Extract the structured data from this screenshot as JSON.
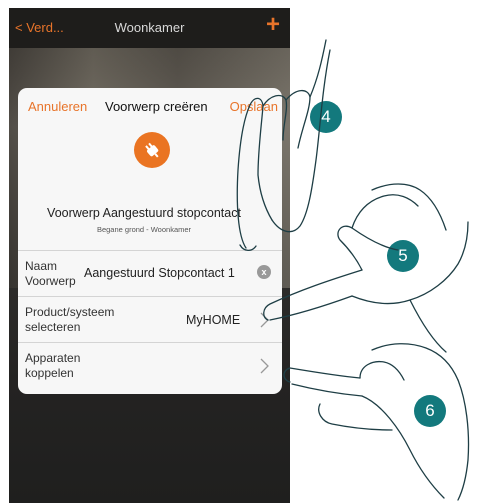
{
  "navbar": {
    "back_label": "< Verd...",
    "title": "Woonkamer",
    "add_label": "+"
  },
  "dialog": {
    "cancel_label": "Annuleren",
    "title": "Voorwerp creëren",
    "save_label": "Opslaan",
    "object_icon": "plug-icon",
    "object_name": "Voorwerp Aangestuurd stopcontact",
    "object_location": "Begane grond - Woonkamer",
    "rows": [
      {
        "label_line1": "Naam",
        "label_line2": "Voorwerp",
        "value": "Aangestuurd Stopcontact 1",
        "action": "x"
      },
      {
        "label_line1": "Product/systeem",
        "label_line2": "selecteren",
        "value": "MyHOME",
        "action": "chevron"
      },
      {
        "label_line1": "Apparaten",
        "label_line2": "koppelen",
        "value": "",
        "action": "chevron"
      }
    ]
  },
  "steps": [
    "4",
    "5",
    "6"
  ],
  "colors": {
    "accent": "#e8742a",
    "step_bubble": "#13797d",
    "icon_circle": "#ea7422"
  }
}
